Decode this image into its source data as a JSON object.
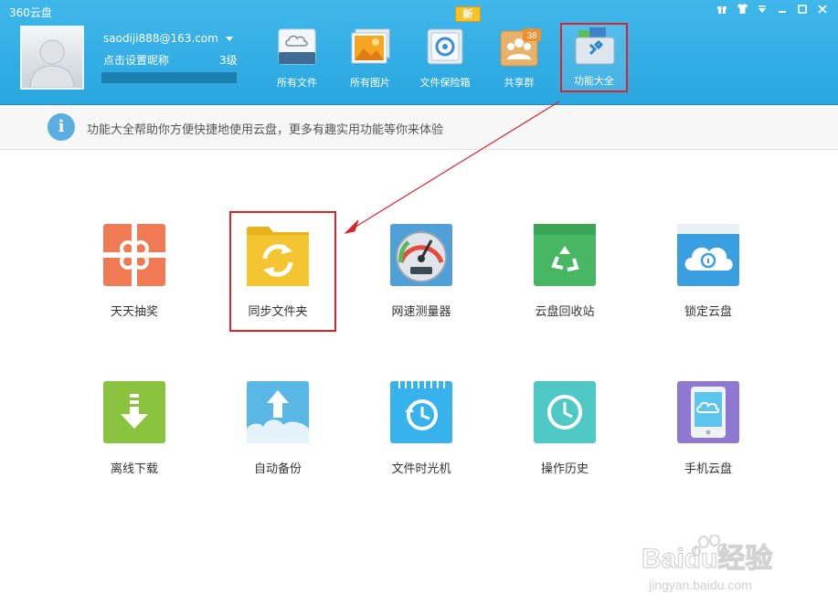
{
  "window": {
    "title": "360云盘",
    "controls": [
      "gift-icon",
      "shirt-icon",
      "menu-icon",
      "minimize-icon",
      "maximize-icon",
      "close-icon"
    ]
  },
  "user": {
    "email": "saodiji888@163.com",
    "nickname": "点击设置昵称",
    "level": "3级",
    "level_progress": 0
  },
  "nav": {
    "new_badge": "新",
    "items": [
      {
        "label": "所有文件",
        "icon": "cloud-disk-icon"
      },
      {
        "label": "所有图片",
        "icon": "pictures-icon"
      },
      {
        "label": "文件保险箱",
        "icon": "safe-icon"
      },
      {
        "label": "共享群",
        "icon": "group-icon",
        "badge": "38"
      },
      {
        "label": "功能大全",
        "icon": "toolbox-icon",
        "active": true
      }
    ]
  },
  "info": {
    "icon": "info-icon",
    "text": "功能大全帮助你方便快捷地使用云盘，更多有趣实用功能等你来体验"
  },
  "features": [
    {
      "label": "天天抽奖",
      "icon": "gift-box-icon",
      "color": "#ef7a54"
    },
    {
      "label": "同步文件夹",
      "icon": "sync-folder-icon",
      "color": "#f4c531",
      "highlighted": true
    },
    {
      "label": "网速测量器",
      "icon": "speedometer-icon",
      "color": "#4f9fd9"
    },
    {
      "label": "云盘回收站",
      "icon": "recycle-bin-icon",
      "color": "#47b763"
    },
    {
      "label": "锁定云盘",
      "icon": "lock-cloud-icon",
      "color": "#3a9fe0"
    },
    {
      "label": "离线下载",
      "icon": "download-icon",
      "color": "#8ac43f"
    },
    {
      "label": "自动备份",
      "icon": "backup-icon",
      "color": "#5ab8e6"
    },
    {
      "label": "文件时光机",
      "icon": "time-machine-icon",
      "color": "#38b2ec"
    },
    {
      "label": "操作历史",
      "icon": "history-icon",
      "color": "#4ec9c5"
    },
    {
      "label": "手机云盘",
      "icon": "mobile-cloud-icon",
      "color": "#8f78d2"
    }
  ],
  "watermark": {
    "brand": "Baidu经验",
    "url": "jingyan.baidu.com"
  }
}
